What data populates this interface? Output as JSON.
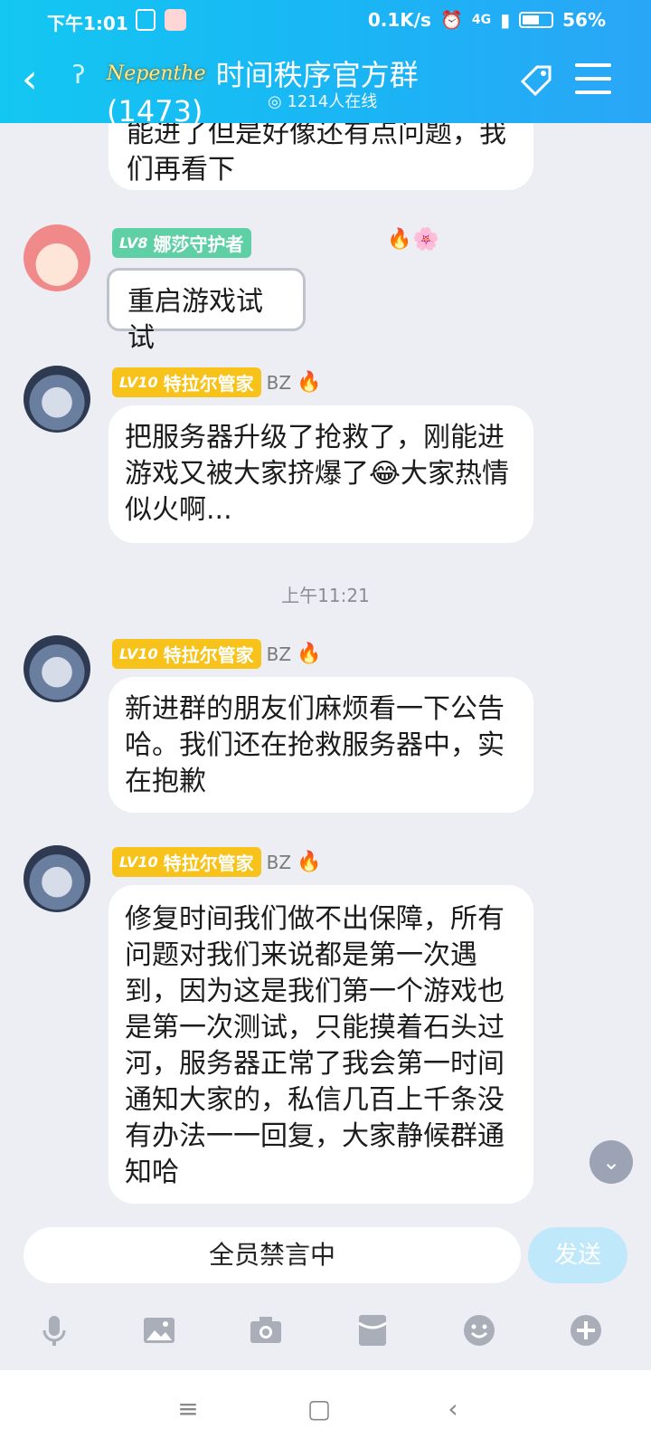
{
  "status_bar": {
    "time": "下午1:01",
    "net_speed": "0.1K/s",
    "network": "4G",
    "battery": "56%"
  },
  "header": {
    "title": "时间秩序官方群(1473)",
    "logo": "Nepenthe",
    "online": "1214人在线"
  },
  "messages": [
    {
      "text": "能进了但是好像还有点问题，我们再看下"
    },
    {
      "level": "LV8",
      "name": "娜莎守护者",
      "text": "重启游戏试试"
    },
    {
      "level": "LV10",
      "name": "特拉尔管家",
      "tag": "BZ",
      "text": "把服务器升级了抢救了，刚能进游戏又被大家挤爆了😂大家热情似火啊..."
    },
    {
      "level": "LV10",
      "name": "特拉尔管家",
      "tag": "BZ",
      "text": "新进群的朋友们麻烦看一下公告哈。我们还在抢救服务器中，实在抱歉"
    },
    {
      "level": "LV10",
      "name": "特拉尔管家",
      "tag": "BZ",
      "text": "修复时间我们做不出保障，所有问题对我们来说都是第一次遇到，因为这是我们第一个游戏也是第一次测试，只能摸着石头过河，服务器正常了我会第一时间通知大家的，私信几百上千条没有办法一一回复，大家静候群通知哈"
    }
  ],
  "timestamp": "上午11:21",
  "input": {
    "muted_text": "全员禁言中",
    "send_label": "发送"
  },
  "toolbar": [
    "mic-icon",
    "image-icon",
    "camera-icon",
    "red-packet-icon",
    "emoji-icon",
    "plus-icon"
  ],
  "colors": {
    "header_start": "#13c7f1",
    "header_end": "#2aa6f7",
    "chat_bg": "#eceef4",
    "level_gold": "#f7c21a",
    "level_green": "#5fd0a6"
  }
}
